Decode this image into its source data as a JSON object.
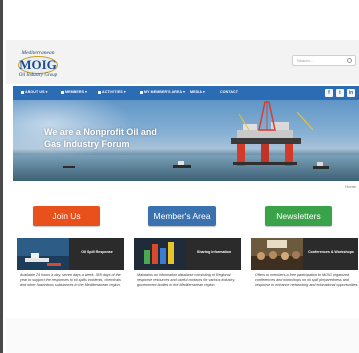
{
  "logo": {
    "line1": "Mediterranean",
    "acronym": "MOIG",
    "line2": "Oil Industry Group"
  },
  "search": {
    "placeholder": "Search..."
  },
  "nav": {
    "items": [
      {
        "label": "ABOUT US"
      },
      {
        "label": "MEMBERS"
      },
      {
        "label": "ACTIVITIES"
      },
      {
        "label": "MY MEMBER'S AREA"
      },
      {
        "label": "MEDIA"
      },
      {
        "label": "CONTACT"
      }
    ],
    "social": [
      "f",
      "t",
      "in"
    ]
  },
  "hero": {
    "title": "We are a Nonprofit Oil and Gas Industry Forum"
  },
  "breadcrumb": {
    "label": "Home"
  },
  "buttons": [
    {
      "label": "Join Us",
      "color": "#e8501c"
    },
    {
      "label": "Member's Area",
      "color": "#3a72b0"
    },
    {
      "label": "Newsletters",
      "color": "#3aa34a"
    }
  ],
  "cards": [
    {
      "caption": "Oil Spill Response",
      "description": "Available 24 hours a day, seven days a week, 365 days of the year to support the responses to oil spills incidents, chemicals and other hazardous substances in the Mediterranean region."
    },
    {
      "caption": "Sharing Information",
      "description": "Maintains an information database consisting of Regional response resources and useful contacts for various industry, government bodies in the Mediterranean region."
    },
    {
      "caption": "Conferences & Workshops",
      "description": "Offers to members a free participation to MOIG organized conferences and workshops on oil spill preparedness and response to enhance networking and educational opportunities."
    }
  ]
}
